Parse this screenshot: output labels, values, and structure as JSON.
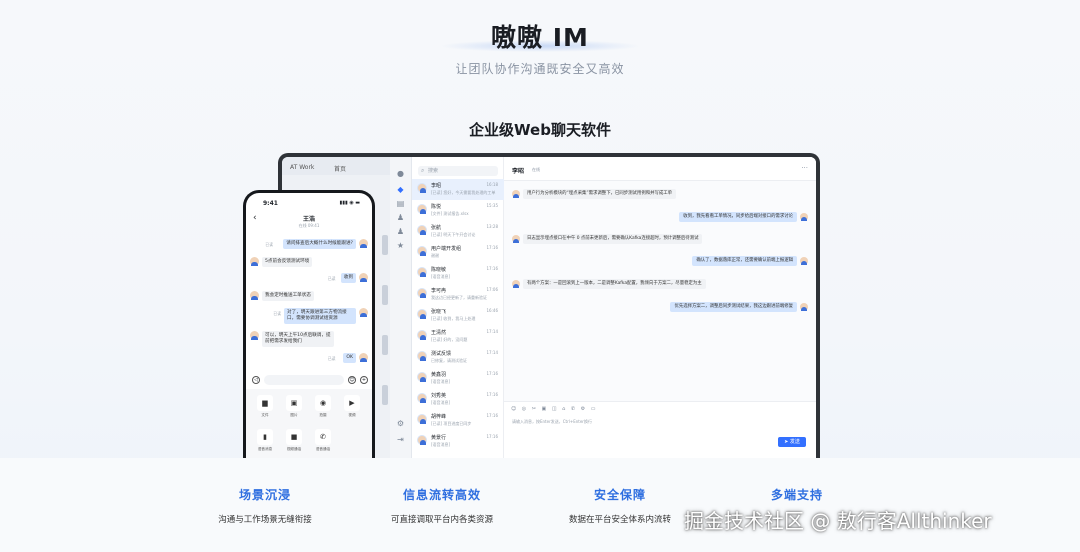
{
  "hero": {
    "title": "嗷嗷 IM",
    "subtitle": "让团队协作沟通既安全又高效"
  },
  "section_title": "企业级Web聊天软件",
  "desktop": {
    "tabs": [
      "AT Work",
      "首页"
    ],
    "search_placeholder": "搜索",
    "conversations": [
      {
        "name": "李昭",
        "time": "16:18",
        "snippet": "[已读] 您好，今天需要我处理的工单"
      },
      {
        "name": "陈悦",
        "time": "15:35",
        "snippet": "[文件] 测试报告.xlsx"
      },
      {
        "name": "张航",
        "time": "13:28",
        "snippet": "[已读] 明天下午开会讨论"
      },
      {
        "name": "用户端开发组",
        "time": "17:16",
        "snippet": "谢谢"
      },
      {
        "name": "陈晓敏",
        "time": "17:16",
        "snippet": "[语音消息]"
      },
      {
        "name": "李可冉",
        "time": "17:06",
        "snippet": "我这边已经更新了，请重新验证"
      },
      {
        "name": "张晓飞",
        "time": "16:46",
        "snippet": "[已读] 收到，我马上处理"
      },
      {
        "name": "王清然",
        "time": "17:14",
        "snippet": "[已读] 好的，没问题"
      },
      {
        "name": "测试反馈",
        "time": "17:14",
        "snippet": "已修复，请测试验证"
      },
      {
        "name": "黄鑫羽",
        "time": "17:16",
        "snippet": "[语音消息]"
      },
      {
        "name": "刘秀英",
        "time": "17:16",
        "snippet": "[语音消息]"
      },
      {
        "name": "胡梓峰",
        "time": "17:16",
        "snippet": "[已读] 项目进度已同步"
      },
      {
        "name": "黄景行",
        "time": "17:16",
        "snippet": "[语音消息]"
      }
    ],
    "chat": {
      "name": "李昭",
      "status": "在线",
      "more": "···",
      "messages": [
        {
          "side": "left",
          "text": "用户行为分析模块的“埋点采集”需求调整下，已同步测试用例和并写成工单"
        },
        {
          "side": "right",
          "text": "收到，我先看看工单情况，同步给后端对接口的需求讨论"
        },
        {
          "side": "left",
          "text": "日志显示埋点接口在中午 0 点前未更新后，需要确认Kafka连接超时，预计调整后待测试"
        },
        {
          "side": "right",
          "text": "确认了，数据落库正常，还需要确认前端上报逻辑"
        },
        {
          "side": "left",
          "text": "有两个方案：一是回滚到上一版本，二是调整Kafka配置，我倾向于方案二，尽量稳定为主"
        },
        {
          "side": "right",
          "text": "优先选择方案二，调整后同步测试结果，我这边跟进前端修复"
        }
      ],
      "tool_icons": "☺ ◎ ✂ ▣ ◫ ⌂ ✆ ⚙ ▭",
      "input_hint": "请输入消息，按Enter发送，Ctrl+Enter换行",
      "send_label": "发送"
    }
  },
  "phone": {
    "time": "9:41",
    "status": "▮▮▮ ◉ ▬",
    "back": "‹",
    "title": "王浩",
    "subtitle": "在线 09:41",
    "messages": [
      {
        "side": "right",
        "text": "请问排查后大概什么时候能跟进?",
        "read": "已读"
      },
      {
        "side": "left",
        "text": "5点前会反馈测试环境"
      },
      {
        "side": "right",
        "text": "收到",
        "read": "已读"
      },
      {
        "side": "left",
        "text": "我会定时推送工单状态"
      },
      {
        "side": "right",
        "text": "对了，明天跟进第三方物流接口，需要协调测试组资源",
        "read": "已读"
      },
      {
        "side": "left",
        "text": "可以，明天上午10点后联调，提前把需求发给我们"
      },
      {
        "side": "right",
        "text": "OK",
        "read": "已读"
      }
    ],
    "tray": [
      {
        "icon": "▆",
        "label": "文件"
      },
      {
        "icon": "▣",
        "label": "图片"
      },
      {
        "icon": "◉",
        "label": "拍摄"
      },
      {
        "icon": "▶",
        "label": "视频"
      },
      {
        "icon": "▮",
        "label": "语音消息"
      },
      {
        "icon": "■",
        "label": "视频通话"
      },
      {
        "icon": "✆",
        "label": "语音通话"
      }
    ]
  },
  "features": [
    {
      "title": "场景沉浸",
      "desc": "沟通与工作场景无缝衔接"
    },
    {
      "title": "信息流转高效",
      "desc": "可直接调取平台内各类资源"
    },
    {
      "title": "安全保障",
      "desc": "数据在平台安全体系内流转"
    },
    {
      "title": "多端支持",
      "desc": ""
    }
  ],
  "watermark": "掘金技术社区 @ 敖行客Allthinker",
  "colors": {
    "accent": "#3370ff",
    "feature_title": "#2f6fe0"
  }
}
